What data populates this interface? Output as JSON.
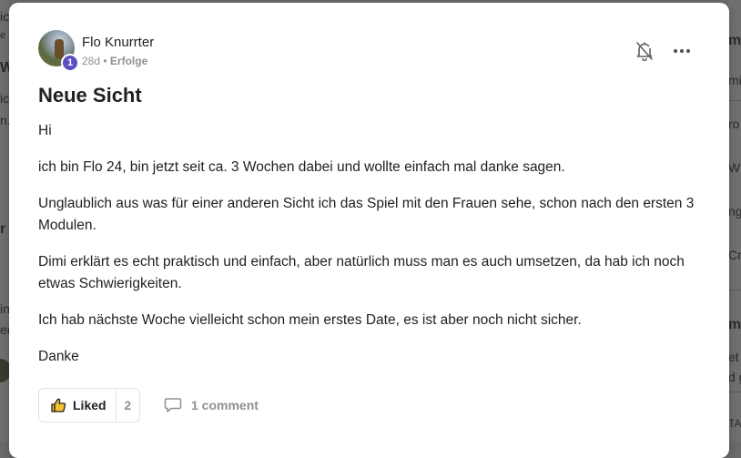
{
  "background": {
    "left_fragments": [
      "ich",
      "e 1",
      "W",
      "ic",
      "n.",
      "r",
      "in",
      "ere"
    ],
    "right_fragments": [
      "mu",
      "mi",
      "ro",
      "W",
      "ng",
      "Cr",
      "mi",
      "et",
      "d g",
      "TA"
    ]
  },
  "post": {
    "author": "Flo Knurrter",
    "level": "1",
    "time": "28d",
    "separator": "•",
    "category": "Erfolge",
    "title": "Neue Sicht",
    "paragraphs": [
      "Hi",
      "ich bin Flo 24, bin jetzt seit ca. 3 Wochen dabei und wollte einfach mal danke sagen.",
      "Unglaublich aus was für einer anderen Sicht ich das Spiel mit den Frauen sehe, schon nach den ersten 3 Modulen.",
      "Dimi erklärt es echt praktisch und einfach, aber natürlich muss man es auch umsetzen, da hab ich noch etwas Schwierigkeiten.",
      "Ich hab nächste Woche vielleicht schon mein erstes Date, es ist aber noch nicht sicher.",
      "Danke"
    ],
    "like_label": "Liked",
    "like_count": "2",
    "comment_label": "1 comment"
  },
  "icons": {
    "bell": "bell-off-icon",
    "more": "more-horizontal-icon",
    "like": "thumbs-up-icon",
    "comment": "comment-icon"
  },
  "colors": {
    "accent_badge": "#5b4fc4",
    "muted_text": "#909090",
    "overlay": "#6b6b6b"
  }
}
